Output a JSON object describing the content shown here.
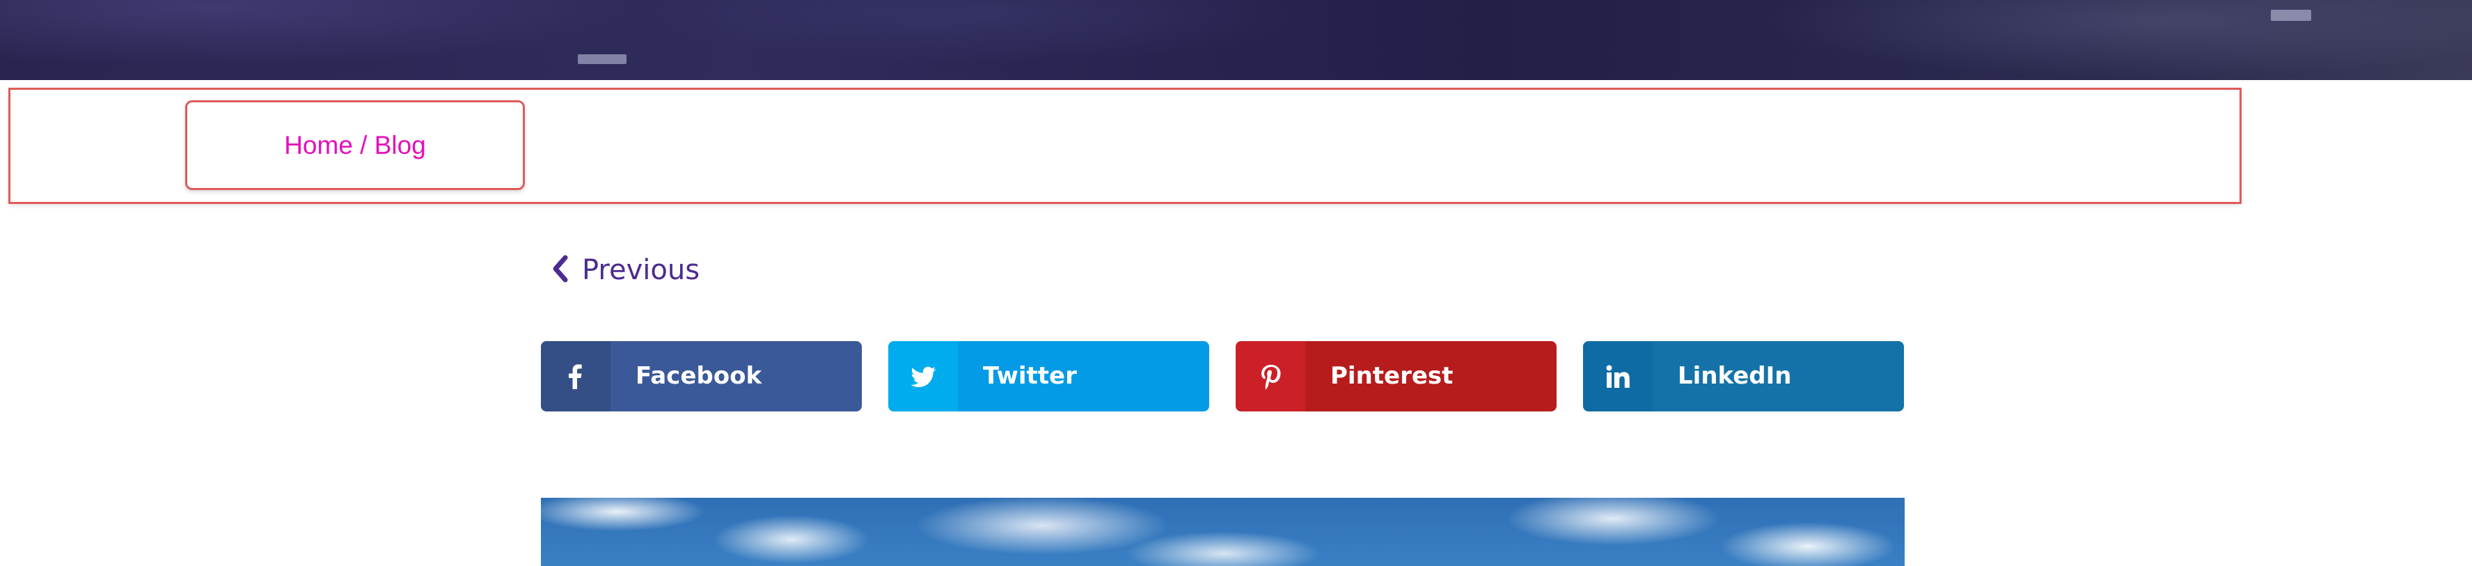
{
  "breadcrumb": {
    "text": "Home / Blog"
  },
  "post_nav": {
    "previous_label": "Previous"
  },
  "share": {
    "buttons": [
      {
        "label": "Facebook",
        "icon": "facebook-icon",
        "color": "#3b5998"
      },
      {
        "label": "Twitter",
        "icon": "twitter-icon",
        "color": "#039be5"
      },
      {
        "label": "Pinterest",
        "icon": "pinterest-icon",
        "color": "#b71c1c"
      },
      {
        "label": "LinkedIn",
        "icon": "linkedin-icon",
        "color": "#1472a8"
      }
    ]
  },
  "colors": {
    "breadcrumb_text": "#e60fb9",
    "highlight_border": "#e05a5a",
    "previous_link": "#4b2b8f"
  }
}
